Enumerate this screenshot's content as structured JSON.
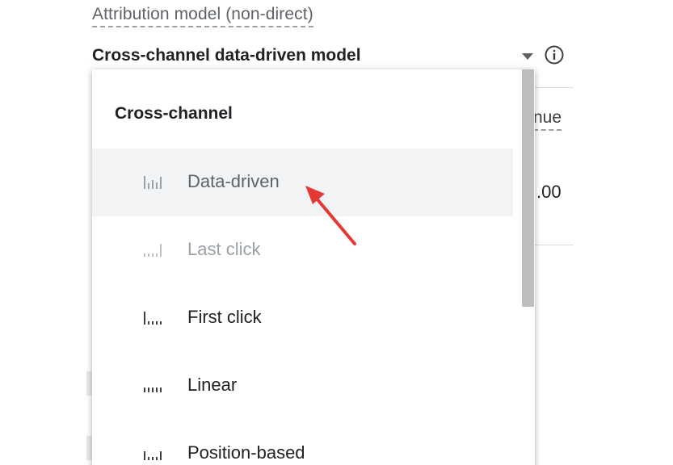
{
  "selector": {
    "label": "Attribution model (non-direct)",
    "value": "Cross-channel data-driven model",
    "caret_icon": "caret-down-icon",
    "info_icon": "info-circle-icon"
  },
  "background_table": {
    "column_header_fragment": "nue",
    "cell_fragment": ".00"
  },
  "menu": {
    "group_header": "Cross-channel",
    "items": [
      {
        "label": "Data-driven",
        "icon": "data-driven-bars-icon",
        "state": "selected"
      },
      {
        "label": "Last click",
        "icon": "last-click-bars-icon",
        "state": "disabled"
      },
      {
        "label": "First click",
        "icon": "first-click-bars-icon",
        "state": "normal"
      },
      {
        "label": "Linear",
        "icon": "linear-bars-icon",
        "state": "normal"
      },
      {
        "label": "Position-based",
        "icon": "position-based-bars-icon",
        "state": "normal"
      }
    ]
  },
  "annotation": {
    "arrow_color": "#e53935",
    "points_to": "Data-driven"
  },
  "colors": {
    "selected_row_bg": "#f1f3f4",
    "disabled_text": "#9aa0a6",
    "primary_text": "#202124",
    "secondary_text": "#5f6368"
  }
}
